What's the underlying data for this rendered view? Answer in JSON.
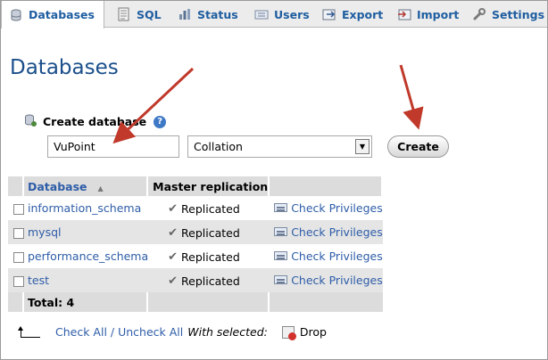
{
  "tabs": [
    {
      "label": "Databases",
      "icon": "database-icon",
      "active": true
    },
    {
      "label": "SQL",
      "icon": "sql-icon"
    },
    {
      "label": "Status",
      "icon": "status-icon"
    },
    {
      "label": "Users",
      "icon": "users-icon"
    },
    {
      "label": "Export",
      "icon": "export-icon"
    },
    {
      "label": "Import",
      "icon": "import-icon"
    },
    {
      "label": "Settings",
      "icon": "wrench-icon"
    }
  ],
  "page_title": "Databases",
  "create": {
    "label": "Create database",
    "help_glyph": "?",
    "name_value": "VuPoint",
    "collation_placeholder": "Collation",
    "button": "Create"
  },
  "table": {
    "headers": {
      "database": "Database",
      "master_replication": "Master replication"
    },
    "rows": [
      {
        "name": "information_schema",
        "replication": "Replicated",
        "privileges": "Check Privileges"
      },
      {
        "name": "mysql",
        "replication": "Replicated",
        "privileges": "Check Privileges"
      },
      {
        "name": "performance_schema",
        "replication": "Replicated",
        "privileges": "Check Privileges"
      },
      {
        "name": "test",
        "replication": "Replicated",
        "privileges": "Check Privileges"
      }
    ],
    "total": "Total: 4"
  },
  "bottom": {
    "check_all": "Check All",
    "separator": " / ",
    "uncheck_all": "Uncheck All",
    "with_selected": "With selected:",
    "drop": "Drop"
  },
  "colors": {
    "link": "#2e5da8",
    "title": "#1b4f8a",
    "annotation_arrow": "#c0392b"
  }
}
